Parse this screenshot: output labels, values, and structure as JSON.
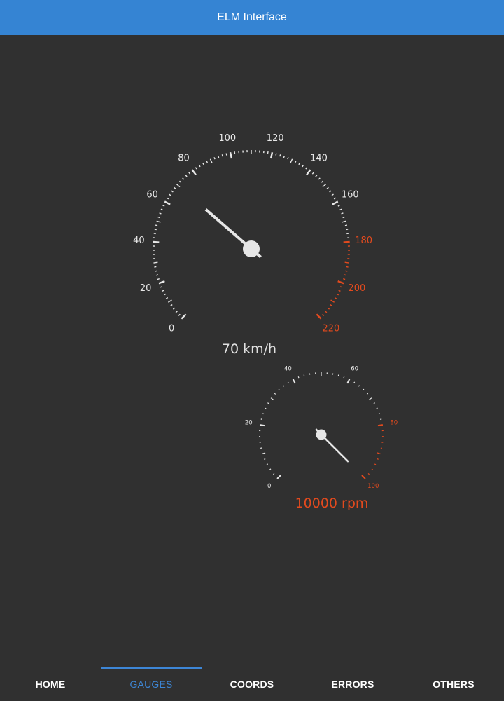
{
  "app": {
    "title": "ELM Interface"
  },
  "colors": {
    "appbar": "#3584d3",
    "background": "#303030",
    "tick_normal": "#e8e8e8",
    "tick_redline": "#e24a1e",
    "tab_active": "#3d86d6"
  },
  "speed_gauge": {
    "min": 0,
    "max": 220,
    "value": 70,
    "redline_from": 180,
    "major_step": 20,
    "minor_step": 2,
    "labels": [
      "0",
      "20",
      "40",
      "60",
      "80",
      "100",
      "120",
      "140",
      "160",
      "180",
      "200",
      "220"
    ],
    "readout": "70 km/h",
    "readout_color": "#e0e0e0"
  },
  "rpm_gauge": {
    "min": 0,
    "max": 100,
    "value": 100,
    "redline_from": 80,
    "major_step": 20,
    "minor_step": 2,
    "labels": [
      "0",
      "20",
      "40",
      "60",
      "80",
      "100"
    ],
    "readout": "10000 rpm",
    "readout_color": "#e24a1e"
  },
  "tabs": [
    {
      "label": "HOME",
      "active": false
    },
    {
      "label": "GAUGES",
      "active": true
    },
    {
      "label": "COORDS",
      "active": false
    },
    {
      "label": "ERRORS",
      "active": false
    },
    {
      "label": "OTHERS",
      "active": false
    }
  ]
}
